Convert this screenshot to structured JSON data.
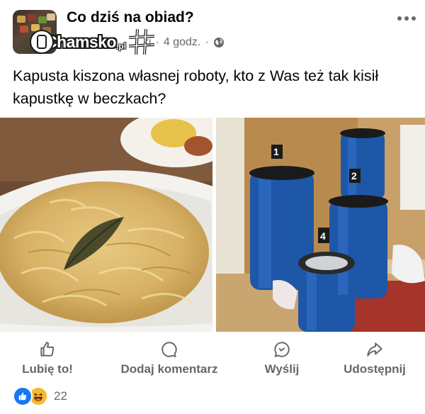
{
  "header": {
    "group_name": "Co dziś na obiad?",
    "author_suffix": "ki",
    "time": "4 godz.",
    "separator": "·",
    "privacy_icon": "globe-icon",
    "more_icon": "more-dots-icon"
  },
  "watermark": {
    "text": "Chamsko",
    "suffix": ".pl"
  },
  "post": {
    "text": "Kapusta kiszona własnej roboty, kto z Was też tak kisił kapustkę w beczkach?"
  },
  "photos": {
    "left_icon": "sauerkraut-bowl-photo",
    "right_icon": "blue-barrels-photo",
    "barrel_numbers": [
      "1",
      "2",
      "4"
    ]
  },
  "actions": [
    {
      "label": "Lubię to!",
      "icon": "thumbs-up-icon"
    },
    {
      "label": "Dodaj komentarz",
      "icon": "comment-icon"
    },
    {
      "label": "Wyślij",
      "icon": "messenger-icon"
    },
    {
      "label": "Udostępnij",
      "icon": "share-icon"
    }
  ],
  "reactions": {
    "count": "22",
    "types": [
      "like-reaction-icon",
      "haha-reaction-icon"
    ]
  },
  "colors": {
    "text_primary": "#050505",
    "text_secondary": "#65676b",
    "like_blue": "#1877f2",
    "haha_yellow": "#f7b928"
  }
}
